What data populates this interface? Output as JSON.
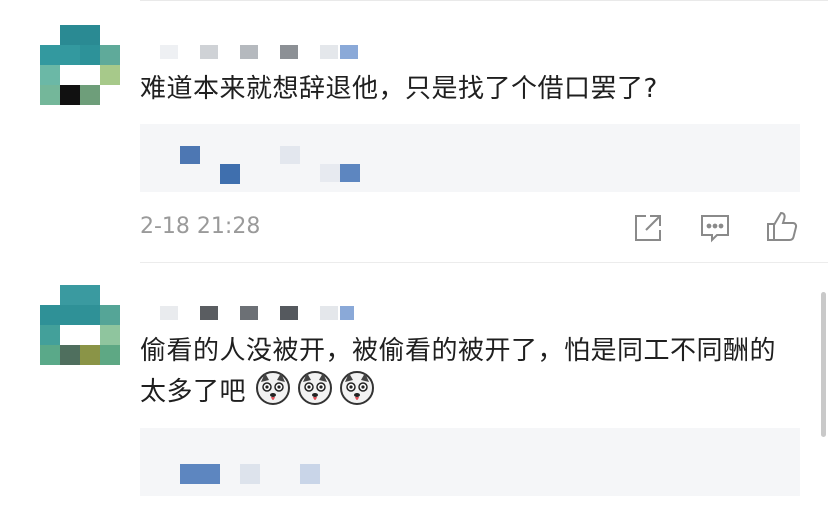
{
  "comments": [
    {
      "text": "难道本来就想辞退他，只是找了个借口罢了?",
      "timestamp": "2-18 21:28",
      "actions": [
        "share-icon",
        "comment-icon",
        "like-icon"
      ]
    },
    {
      "text": "偷看的人没被开，被偷看的被开了，怕是同工不同酬的太多了吧",
      "emoji": [
        "husky-emoji",
        "husky-emoji",
        "husky-emoji"
      ]
    }
  ],
  "colors": {
    "avatar_teal": "#2f8f96",
    "mosaic_blue": "#4a78b5",
    "reply_bg": "#f5f6f8",
    "timestamp": "#9a9a9a"
  }
}
